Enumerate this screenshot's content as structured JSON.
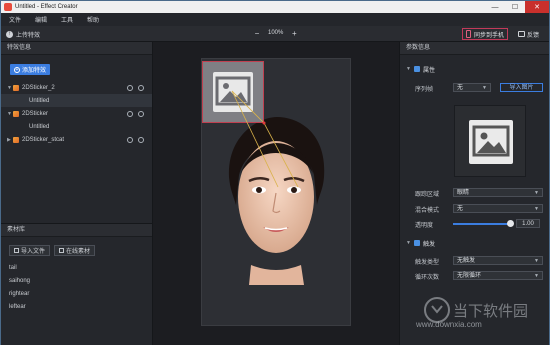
{
  "window": {
    "title": "Untitled - Effect Creator",
    "minimize": "—",
    "maximize": "☐",
    "close": "✕"
  },
  "menu": [
    "文件",
    "编辑",
    "工具",
    "帮助"
  ],
  "toolbar": {
    "upload": "上传特效",
    "zoom": "100%",
    "zoom_out": "−",
    "zoom_in": "+",
    "sync": "同步到手机",
    "feedback": "反馈"
  },
  "left": {
    "effects_header": "特效信息",
    "add_effect": "添加特效",
    "tree": [
      {
        "label": "2DSticker_2",
        "level": 0,
        "expanded": true
      },
      {
        "label": "Untitled",
        "level": 1,
        "selected": true
      },
      {
        "label": "2DSticker",
        "level": 0,
        "expanded": true
      },
      {
        "label": "Untitled",
        "level": 1
      },
      {
        "label": "2DSticker_stcat",
        "level": 0,
        "expanded": false
      }
    ],
    "materials_header": "素材库",
    "import_file": "导入文件",
    "online_material": "在线素材",
    "materials": [
      "tail",
      "saihong",
      "rightear",
      "leftear"
    ]
  },
  "right": {
    "header": "参数信息",
    "attr_group": "属性",
    "seq_label": "序列帧",
    "seq_value": "无",
    "import_image": "导入图片",
    "follow_label": "跟踪区域",
    "follow_value": "眼睛",
    "blend_label": "混合模式",
    "blend_value": "无",
    "opacity_label": "透明度",
    "opacity_value": "1.00",
    "opacity_fraction": 1.0,
    "trigger_group": "触发",
    "trigger_type_label": "触发类型",
    "trigger_type_value": "无触发",
    "loop_label": "循环次数",
    "loop_value": "无限循环"
  },
  "watermark": {
    "brand": "当下软件园",
    "url": "www.downxia.com"
  },
  "colors": {
    "accent": "#3b7de0",
    "sync_border": "#c23a5a",
    "selection": "#c04050"
  }
}
